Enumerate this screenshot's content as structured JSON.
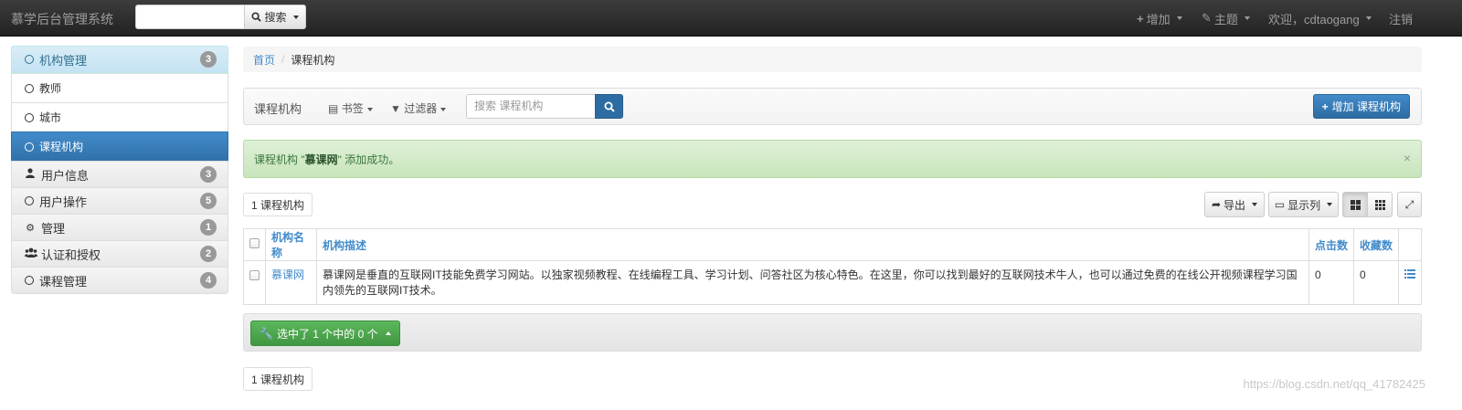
{
  "navbar": {
    "brand": "慕学后台管理系统",
    "search_button": "搜索",
    "add_menu": "增加",
    "theme_menu": "主题",
    "user_menu": "欢迎，cdtaogang",
    "logout": "注销"
  },
  "sidebar": {
    "items": [
      {
        "label": "机构管理",
        "badge": "3"
      },
      {
        "label": "教师"
      },
      {
        "label": "城市"
      },
      {
        "label": "课程机构"
      },
      {
        "label": "用户信息",
        "badge": "3"
      },
      {
        "label": "用户操作",
        "badge": "5"
      },
      {
        "label": "管理",
        "badge": "1"
      },
      {
        "label": "认证和授权",
        "badge": "2"
      },
      {
        "label": "课程管理",
        "badge": "4"
      }
    ]
  },
  "breadcrumb": {
    "home": "首页",
    "current": "课程机构"
  },
  "toolbar": {
    "title": "课程机构",
    "bookmarks": "书签",
    "filters": "过滤器",
    "search_placeholder": "搜索 课程机构",
    "add_button": "增加 课程机构"
  },
  "alert": {
    "prefix": "课程机构 \"",
    "name": "慕课网",
    "suffix": "\" 添加成功。",
    "close": "×"
  },
  "result_count": "1 课程机构",
  "list_tools": {
    "export": "导出",
    "columns": "显示列"
  },
  "table": {
    "headers": [
      "机构名称",
      "机构描述",
      "点击数",
      "收藏数"
    ],
    "rows": [
      {
        "name": "慕课网",
        "desc": "慕课网是垂直的互联网IT技能免费学习网站。以独家视频教程、在线编程工具、学习计划、问答社区为核心特色。在这里，你可以找到最好的互联网技术牛人，也可以通过免费的在线公开视频课程学习国内领先的互联网IT技术。",
        "clicks": "0",
        "favs": "0"
      }
    ]
  },
  "action_button": "选中了 1 个中的 0 个",
  "footer_count": "1 课程机构",
  "watermark": "https://blog.csdn.net/qq_41782425",
  "colors": {
    "primary": "#428bca",
    "success": "#5cb85c",
    "navbar": "#222222"
  }
}
